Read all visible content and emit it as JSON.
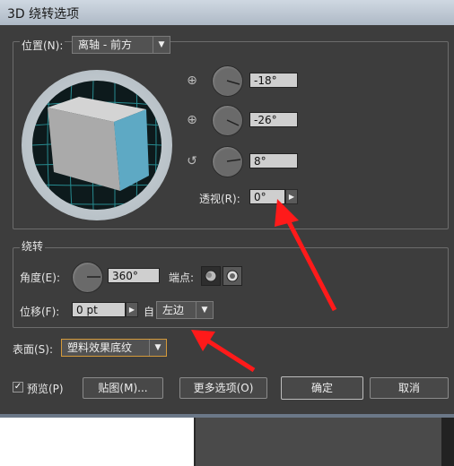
{
  "dialog": {
    "title": "3D 绕转选项"
  },
  "position": {
    "label": "位置(N):",
    "preset": "离轴 - 前方",
    "x_rotation": "-18°",
    "y_rotation": "-26°",
    "z_rotation": "8°",
    "perspective_label": "透视(R):",
    "perspective": "0°"
  },
  "revolve": {
    "group_label": "绕转",
    "angle_label": "角度(E):",
    "angle": "360°",
    "cap_label": "端点:",
    "offset_label": "位移(F):",
    "offset": "0 pt",
    "from_label": "自",
    "from_value": "左边"
  },
  "surface": {
    "label": "表面(S):",
    "value": "塑料效果底纹"
  },
  "buttons": {
    "preview": "预览(P)",
    "map": "贴图(M)...",
    "more_options": "更多选项(O)",
    "ok": "确定",
    "cancel": "取消"
  },
  "colors": {
    "annotation_arrow": "#ff1a1a",
    "cube_front": "#5ea9c4",
    "dialog_bg": "#3d3d3d"
  },
  "icons": [
    "x-axis-rotation-icon",
    "y-axis-rotation-icon",
    "z-axis-rotation-icon",
    "cap-on-icon",
    "cap-off-icon",
    "checkbox-checked-icon",
    "chevron-down-icon",
    "chevron-right-icon"
  ]
}
